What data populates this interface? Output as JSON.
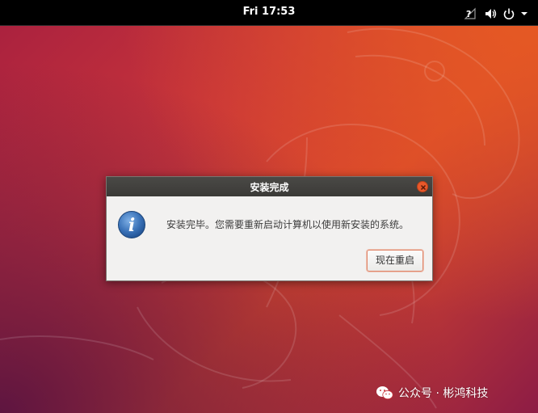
{
  "topbar": {
    "clock": "Fri 17:53",
    "tray_icons": [
      "network-unknown-icon",
      "volume-icon",
      "power-icon",
      "caret-down-icon"
    ]
  },
  "dialog": {
    "title": "安装完成",
    "message": "安装完毕。您需要重新启动计算机以使用新安装的系统。",
    "restart_button": "现在重启",
    "icon": "info-icon"
  },
  "watermark": {
    "text": "公众号 · 彬鸿科技"
  },
  "colors": {
    "accent": "#e9582a",
    "topbar": "#000000",
    "dialog_bg": "#f2f1f0",
    "titlebar": "#3f3e3b"
  }
}
